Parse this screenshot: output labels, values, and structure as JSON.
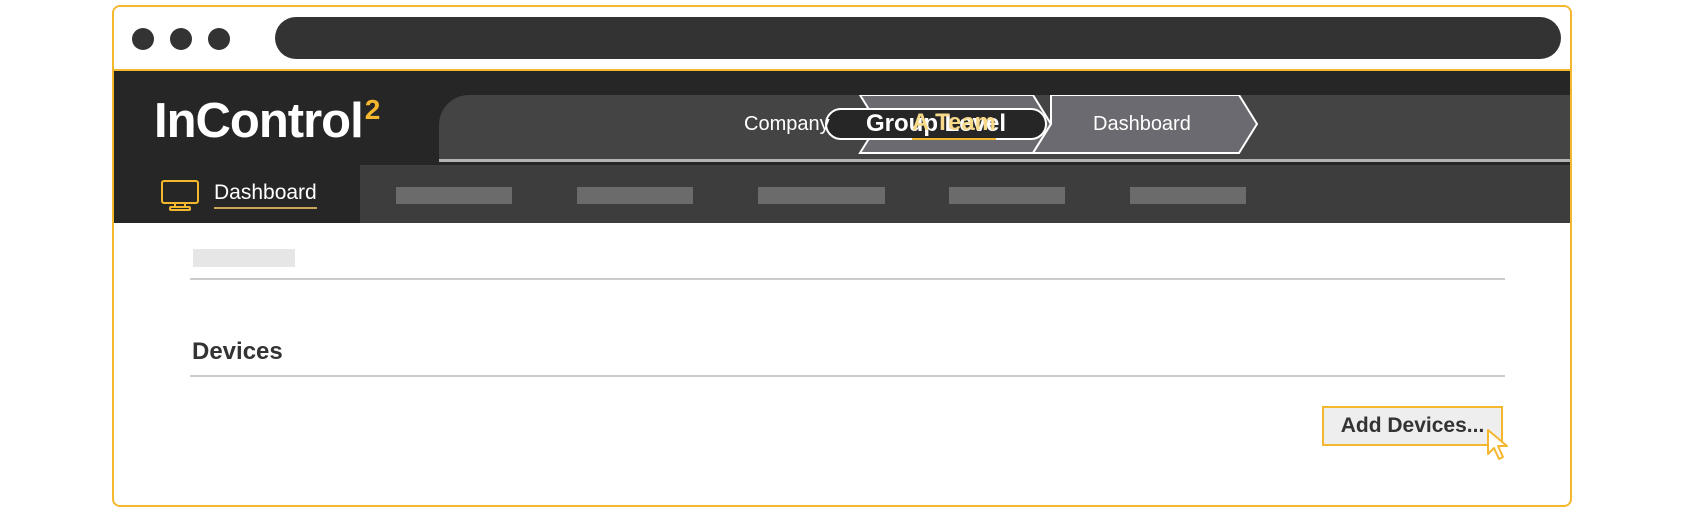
{
  "app": {
    "logo_text": "InControl",
    "logo_superscript": "2"
  },
  "breadcrumb": {
    "level_label": "Group Level",
    "items": [
      "Company",
      "A Team",
      "Dashboard"
    ]
  },
  "nav": {
    "active_label": "Dashboard",
    "active_icon": "monitor-icon"
  },
  "section": {
    "title": "Devices"
  },
  "actions": {
    "add_devices_label": "Add Devices..."
  },
  "colors": {
    "accent": "#f5b72e",
    "dark": "#262626",
    "breadcrumb_active": "#f7d98a"
  }
}
